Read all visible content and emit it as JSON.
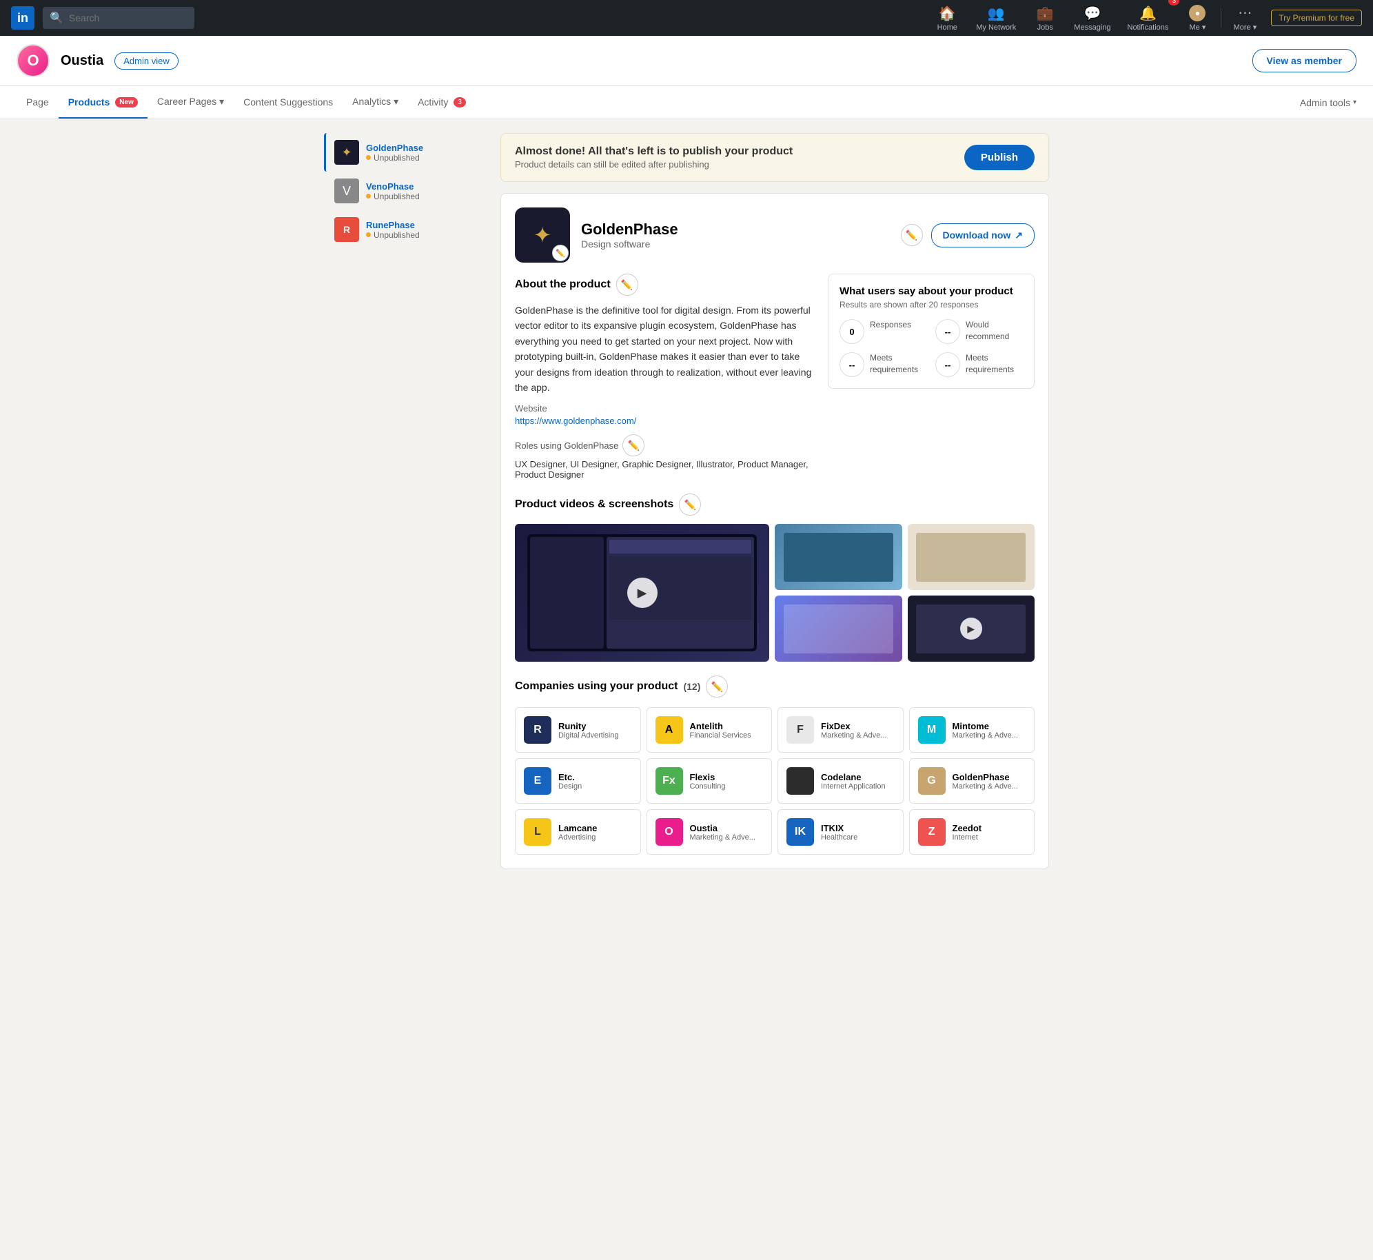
{
  "topnav": {
    "logo": "in",
    "search_placeholder": "Search",
    "nav_items": [
      {
        "id": "home",
        "label": "Home",
        "icon": "🏠"
      },
      {
        "id": "my-network",
        "label": "My Network",
        "icon": "👥"
      },
      {
        "id": "jobs",
        "label": "Jobs",
        "icon": "💼"
      },
      {
        "id": "messaging",
        "label": "Messaging",
        "icon": "💬"
      },
      {
        "id": "notifications",
        "label": "Notifications",
        "icon": "🔔",
        "badge": "3"
      },
      {
        "id": "me",
        "label": "Me ▾",
        "icon": "👤"
      },
      {
        "id": "more",
        "label": "More ▾",
        "icon": "⋯"
      }
    ],
    "try_premium": "Try Premium for free"
  },
  "company_header": {
    "logo_text": "O",
    "company_name": "Oustia",
    "admin_badge": "Admin view",
    "view_member_btn": "View as member"
  },
  "sub_nav": {
    "links": [
      {
        "id": "page",
        "label": "Page",
        "active": false
      },
      {
        "id": "products",
        "label": "Products",
        "active": true,
        "badge": "New"
      },
      {
        "id": "career-pages",
        "label": "Career Pages",
        "dropdown": true
      },
      {
        "id": "content-suggestions",
        "label": "Content Suggestions"
      },
      {
        "id": "analytics",
        "label": "Analytics",
        "dropdown": true
      },
      {
        "id": "activity",
        "label": "Activity",
        "badge_count": "3"
      }
    ],
    "admin_tools": "Admin tools"
  },
  "sidebar": {
    "products": [
      {
        "id": "golden-phase",
        "name": "GoldenPhase",
        "status": "Unpublished",
        "active": true,
        "color": "#1a1a2e"
      },
      {
        "id": "veno-phase",
        "name": "VenoPhase",
        "status": "Unpublished",
        "active": false,
        "color": "#555"
      },
      {
        "id": "rune-phase",
        "name": "RunePhase",
        "status": "Unpublished",
        "active": false,
        "color": "#e74c3c"
      }
    ]
  },
  "publish_banner": {
    "title": "Almost done! All that's left is to publish your product",
    "subtitle": "Product details can still be edited after publishing",
    "publish_btn": "Publish"
  },
  "product": {
    "name": "GoldenPhase",
    "subtitle": "Design software",
    "download_btn": "Download now",
    "about_title": "About the product",
    "description": "GoldenPhase is the definitive tool for digital design. From its powerful vector editor to its expansive plugin ecosystem, GoldenPhase has everything you need to get started on your next project. Now with prototyping built-in, GoldenPhase makes it easier than ever to take your designs from ideation through to realization, without ever leaving the app.",
    "website_label": "Website",
    "website_url": "https://www.goldenphase.com/",
    "roles_label": "Roles using GoldenPhase",
    "roles_text": "UX Designer, UI Designer, Graphic Designer, Illustrator, Product Manager, Product Designer",
    "videos_title": "Product videos & screenshots"
  },
  "reviews": {
    "title": "What users say about your product",
    "subtitle": "Results are shown after 20 responses",
    "items": [
      {
        "id": "responses",
        "count": "0",
        "label": "Responses"
      },
      {
        "id": "would-recommend",
        "count": "--",
        "label": "Would recommend"
      },
      {
        "id": "meets-req-1",
        "count": "--",
        "label": "Meets requirements"
      },
      {
        "id": "meets-req-2",
        "count": "--",
        "label": "Meets requirements"
      }
    ]
  },
  "companies": {
    "title": "Companies using your product",
    "count": "(12)",
    "list": [
      {
        "id": "runity",
        "name": "Runity",
        "type": "Digital Advertising",
        "bg": "#1e2d5a",
        "text": "white",
        "abbr": "R"
      },
      {
        "id": "antelith",
        "name": "Antelith",
        "type": "Financial Services",
        "bg": "#f5c518",
        "text": "black",
        "abbr": "A"
      },
      {
        "id": "fixdex",
        "name": "FixDex",
        "type": "Marketing & Adve...",
        "bg": "#e8e8e8",
        "text": "#333",
        "abbr": "F"
      },
      {
        "id": "mintome",
        "name": "Mintome",
        "type": "Marketing & Adve...",
        "bg": "#00bcd4",
        "text": "white",
        "abbr": "M"
      },
      {
        "id": "etc",
        "name": "Etc.",
        "type": "Design",
        "bg": "#1565c0",
        "text": "white",
        "abbr": "E"
      },
      {
        "id": "flexis",
        "name": "Flexis",
        "type": "Consulting",
        "bg": "#4caf50",
        "text": "white",
        "abbr": "Fx"
      },
      {
        "id": "codelane",
        "name": "Codelane",
        "type": "Internet Application",
        "bg": "#2c2c2c",
        "text": "white",
        "abbr": "</>"
      },
      {
        "id": "goldenphase",
        "name": "GoldenPhase",
        "type": "Marketing & Adve...",
        "bg": "#c8a46e",
        "text": "white",
        "abbr": "G"
      },
      {
        "id": "lamcane",
        "name": "Lamcane",
        "type": "Advertising",
        "bg": "#f5c518",
        "text": "#333",
        "abbr": "L"
      },
      {
        "id": "oustia",
        "name": "Oustia",
        "type": "Marketing & Adve...",
        "bg": "#e91e8c",
        "text": "white",
        "abbr": "O"
      },
      {
        "id": "itkix",
        "name": "ITKIX",
        "type": "Healthcare",
        "bg": "#1565c0",
        "text": "white",
        "abbr": "IK"
      },
      {
        "id": "zeedot",
        "name": "Zeedot",
        "type": "Internet",
        "bg": "#ef5350",
        "text": "white",
        "abbr": "Z"
      }
    ]
  }
}
